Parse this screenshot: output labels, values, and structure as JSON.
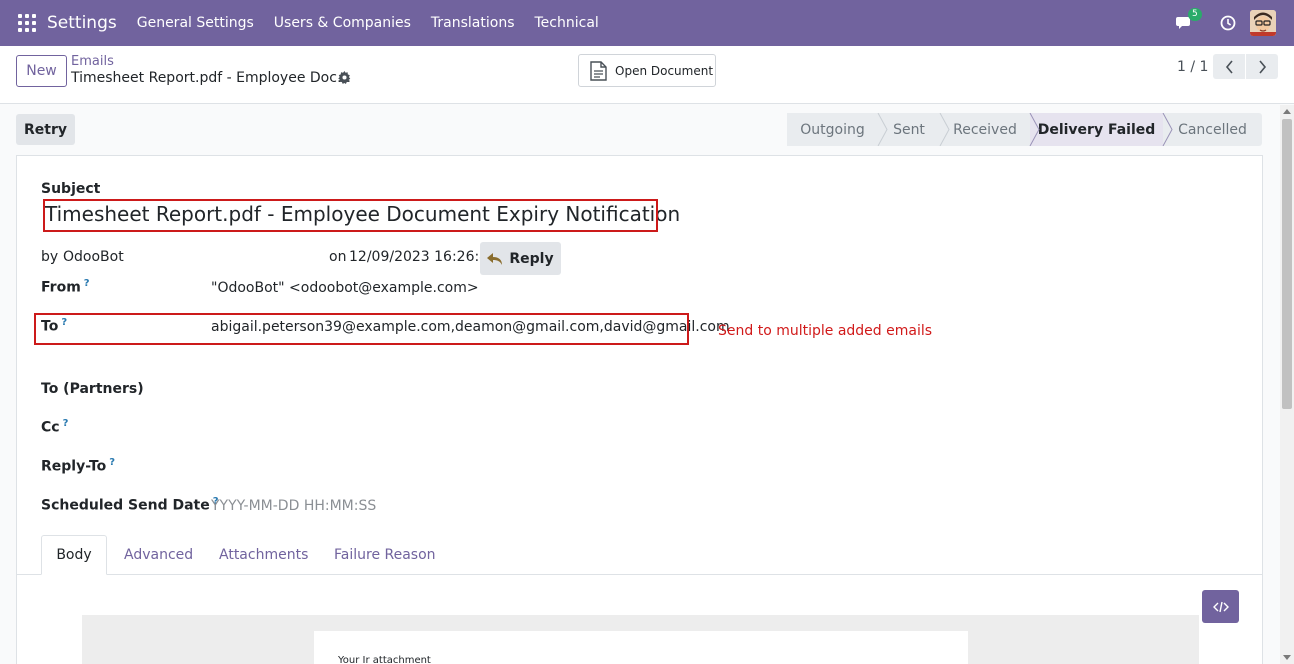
{
  "navbar": {
    "brand": "Settings",
    "menu": [
      "General Settings",
      "Users & Companies",
      "Translations",
      "Technical"
    ],
    "chat_badge": "5"
  },
  "control": {
    "new_label": "New",
    "breadcrumb_parent": "Emails",
    "breadcrumb_current": "Timesheet Report.pdf - Employee Doc…",
    "open_document_label": "Open Document",
    "pager": "1 / 1"
  },
  "actions": {
    "retry_label": "Retry"
  },
  "statusbar": {
    "stages": [
      "Outgoing",
      "Sent",
      "Received",
      "Delivery Failed",
      "Cancelled"
    ],
    "active": "Delivery Failed"
  },
  "form": {
    "subject_label": "Subject",
    "subject": "Timesheet Report.pdf - Employee Document Expiry Notification",
    "by_label": "by",
    "author": "OdooBot",
    "date_prefix": "on",
    "date": "12/09/2023 16:26:46",
    "reply_label": "Reply",
    "from_label": "From",
    "from_value": "\"OdooBot\" <odoobot@example.com>",
    "to_label": "To",
    "to_value": "abigail.peterson39@example.com,deamon@gmail.com,david@gmail.com",
    "annotation": "Send to multiple added emails",
    "to_partners_label": "To (Partners)",
    "cc_label": "Cc",
    "reply_to_label": "Reply-To",
    "scheduled_label": "Scheduled Send Date",
    "scheduled_placeholder": "YYYY-MM-DD HH:MM:SS",
    "help_mark": "?"
  },
  "tabs": [
    "Body",
    "Advanced",
    "Attachments",
    "Failure Reason"
  ],
  "body_preview": {
    "text": "Your Ir attachment"
  },
  "colors": {
    "brand": "#71639e",
    "annotation": "#d11a1a",
    "badge": "#2aab6a"
  }
}
